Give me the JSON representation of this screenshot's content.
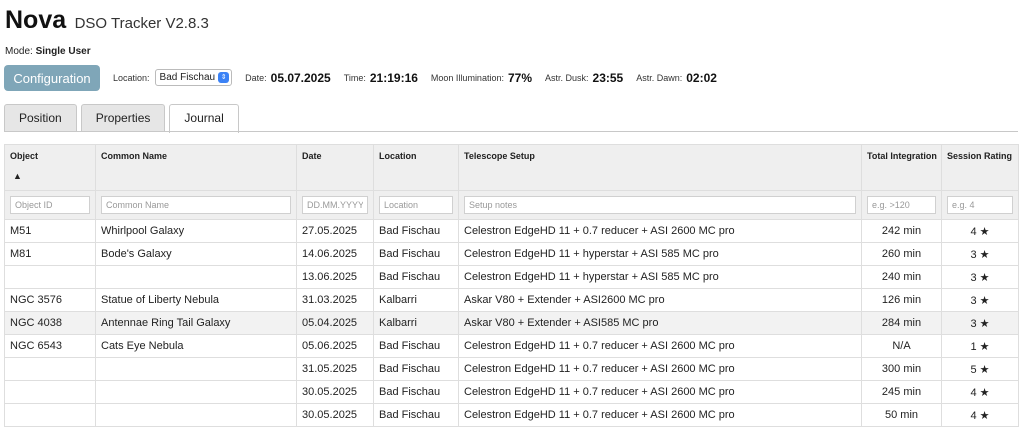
{
  "header": {
    "app_name": "Nova",
    "subtitle": "DSO Tracker V2.8.3"
  },
  "mode": {
    "label": "Mode:",
    "value": "Single User"
  },
  "config_button": "Configuration",
  "info": {
    "location_label": "Location:",
    "location_value": "Bad Fischau",
    "date_label": "Date:",
    "date_value": "05.07.2025",
    "time_label": "Time:",
    "time_value": "21:19:16",
    "moon_label": "Moon Illumination:",
    "moon_value": "77%",
    "dusk_label": "Astr. Dusk:",
    "dusk_value": "23:55",
    "dawn_label": "Astr. Dawn:",
    "dawn_value": "02:02"
  },
  "tabs": [
    {
      "label": "Position",
      "active": false
    },
    {
      "label": "Properties",
      "active": false
    },
    {
      "label": "Journal",
      "active": true
    }
  ],
  "table": {
    "headers": [
      "Object",
      "Common Name",
      "Date",
      "Location",
      "Telescope Setup",
      "Total Integration",
      "Session Rating"
    ],
    "sort_indicator": "▲",
    "filters": [
      "Object ID",
      "Common Name",
      "DD.MM.YYYY",
      "Location",
      "Setup notes",
      "e.g. >120",
      "e.g. 4"
    ],
    "rows": [
      {
        "object": "M51",
        "name": "Whirlpool Galaxy",
        "date": "27.05.2025",
        "location": "Bad Fischau",
        "setup": "Celestron EdgeHD 11 + 0.7 reducer + ASI 2600 MC pro",
        "integration": "242 min",
        "rating": "4 ★",
        "highlight": false
      },
      {
        "object": "M81",
        "name": "Bode's Galaxy",
        "date": "14.06.2025",
        "location": "Bad Fischau",
        "setup": "Celestron EdgeHD 11 + hyperstar + ASI 585 MC pro",
        "integration": "260 min",
        "rating": "3 ★",
        "highlight": false
      },
      {
        "object": "",
        "name": "",
        "date": "13.06.2025",
        "location": "Bad Fischau",
        "setup": "Celestron EdgeHD 11 + hyperstar + ASI 585 MC pro",
        "integration": "240 min",
        "rating": "3 ★",
        "highlight": false
      },
      {
        "object": "NGC 3576",
        "name": "Statue of Liberty Nebula",
        "date": "31.03.2025",
        "location": "Kalbarri",
        "setup": "Askar V80 + Extender + ASI2600 MC pro",
        "integration": "126 min",
        "rating": "3 ★",
        "highlight": false
      },
      {
        "object": "NGC 4038",
        "name": "Antennae Ring Tail Galaxy",
        "date": "05.04.2025",
        "location": "Kalbarri",
        "setup": "Askar V80 + Extender + ASI585 MC pro",
        "integration": "284 min",
        "rating": "3 ★",
        "highlight": true
      },
      {
        "object": "NGC 6543",
        "name": "Cats Eye Nebula",
        "date": "05.06.2025",
        "location": "Bad Fischau",
        "setup": "Celestron EdgeHD 11 + 0.7 reducer + ASI 2600 MC pro",
        "integration": "N/A",
        "rating": "1 ★",
        "highlight": false
      },
      {
        "object": "",
        "name": "",
        "date": "31.05.2025",
        "location": "Bad Fischau",
        "setup": "Celestron EdgeHD 11 + 0.7 reducer + ASI 2600 MC pro",
        "integration": "300 min",
        "rating": "5 ★",
        "highlight": false
      },
      {
        "object": "",
        "name": "",
        "date": "30.05.2025",
        "location": "Bad Fischau",
        "setup": "Celestron EdgeHD 11 + 0.7 reducer + ASI 2600 MC pro",
        "integration": "245 min",
        "rating": "4 ★",
        "highlight": false
      },
      {
        "object": "",
        "name": "",
        "date": "30.05.2025",
        "location": "Bad Fischau",
        "setup": "Celestron EdgeHD 11 + 0.7 reducer + ASI 2600 MC pro",
        "integration": "50 min",
        "rating": "4 ★",
        "highlight": false
      }
    ]
  },
  "colors": {
    "config_button": "#7fa6b8",
    "select_chevron": "#3b82f6"
  }
}
